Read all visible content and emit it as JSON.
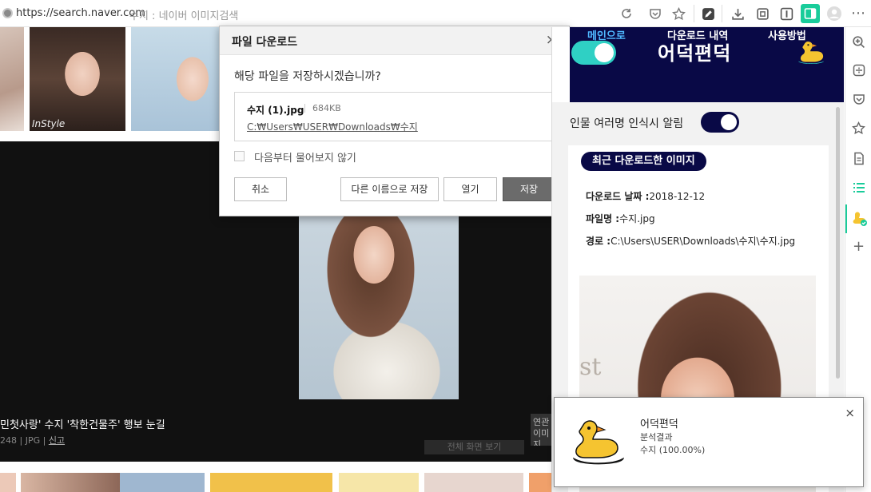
{
  "browser": {
    "url": "https://search.naver.com",
    "page_title": "수지 : 네이버 이미지검색"
  },
  "viewer": {
    "thumb_caption": "InStyle",
    "caption": "민첫사랑' 수지 '착한건물주' 행보 눈길",
    "meta_size": "248",
    "meta_type": "JPG",
    "meta_report": "신고",
    "related_label": "연관 이미지",
    "fullview_label": "전체 화면 보기"
  },
  "dialog": {
    "title": "파일 다운로드",
    "close_icon": "×",
    "question": "해당 파일을 저장하시겠습니까?",
    "file_name": "수지 (1).jpg",
    "file_size": "684KB",
    "file_path": "C:₩Users₩USER₩Downloads₩수지",
    "checkbox_label": "다음부터 물어보지 않기",
    "btn_cancel": "취소",
    "btn_save_as": "다른 이름으로 저장",
    "btn_open": "열기",
    "btn_save": "저장"
  },
  "panel": {
    "title": "어덕편덕",
    "tabs": [
      "메인으로",
      "다운로드 내역",
      "사용방법"
    ],
    "active_tab": 0,
    "face_alert_label": "인물 여러명 인식시 알림",
    "face_alert_on": true,
    "enabled": true,
    "recent_heading": "최근 다운로드한 이미지",
    "download_date_label": "다운로드 날짜 :",
    "download_date": "2018-12-12",
    "file_name_label": "파일명 :",
    "file_name": "수지.jpg",
    "path_label": "경로 :",
    "path": "C:\\Users\\USER\\Downloads\\수지\\수지.jpg",
    "image_text": "st"
  },
  "toast": {
    "app_name": "어덕편덕",
    "line1": "분석결과",
    "line2": "수지 (100.00%)",
    "close_icon": "×"
  },
  "colors": {
    "panel_navy": "#090946",
    "toggle_teal": "#2fd0c4",
    "active_tab": "#4fb8ff",
    "whale_green": "#19cc9a"
  },
  "icons": {
    "toolbar": [
      "refresh-icon",
      "pocket-icon",
      "star-icon",
      "pen-icon",
      "download-icon",
      "capture-icon",
      "reader-icon",
      "sidebar-icon",
      "profile-icon",
      "more-icon"
    ],
    "rail": [
      "zoom-icon",
      "calculator-icon",
      "pocket-icon",
      "favorite-icon",
      "memo-icon",
      "list-icon",
      "duck-extension-icon",
      "add-icon"
    ]
  }
}
